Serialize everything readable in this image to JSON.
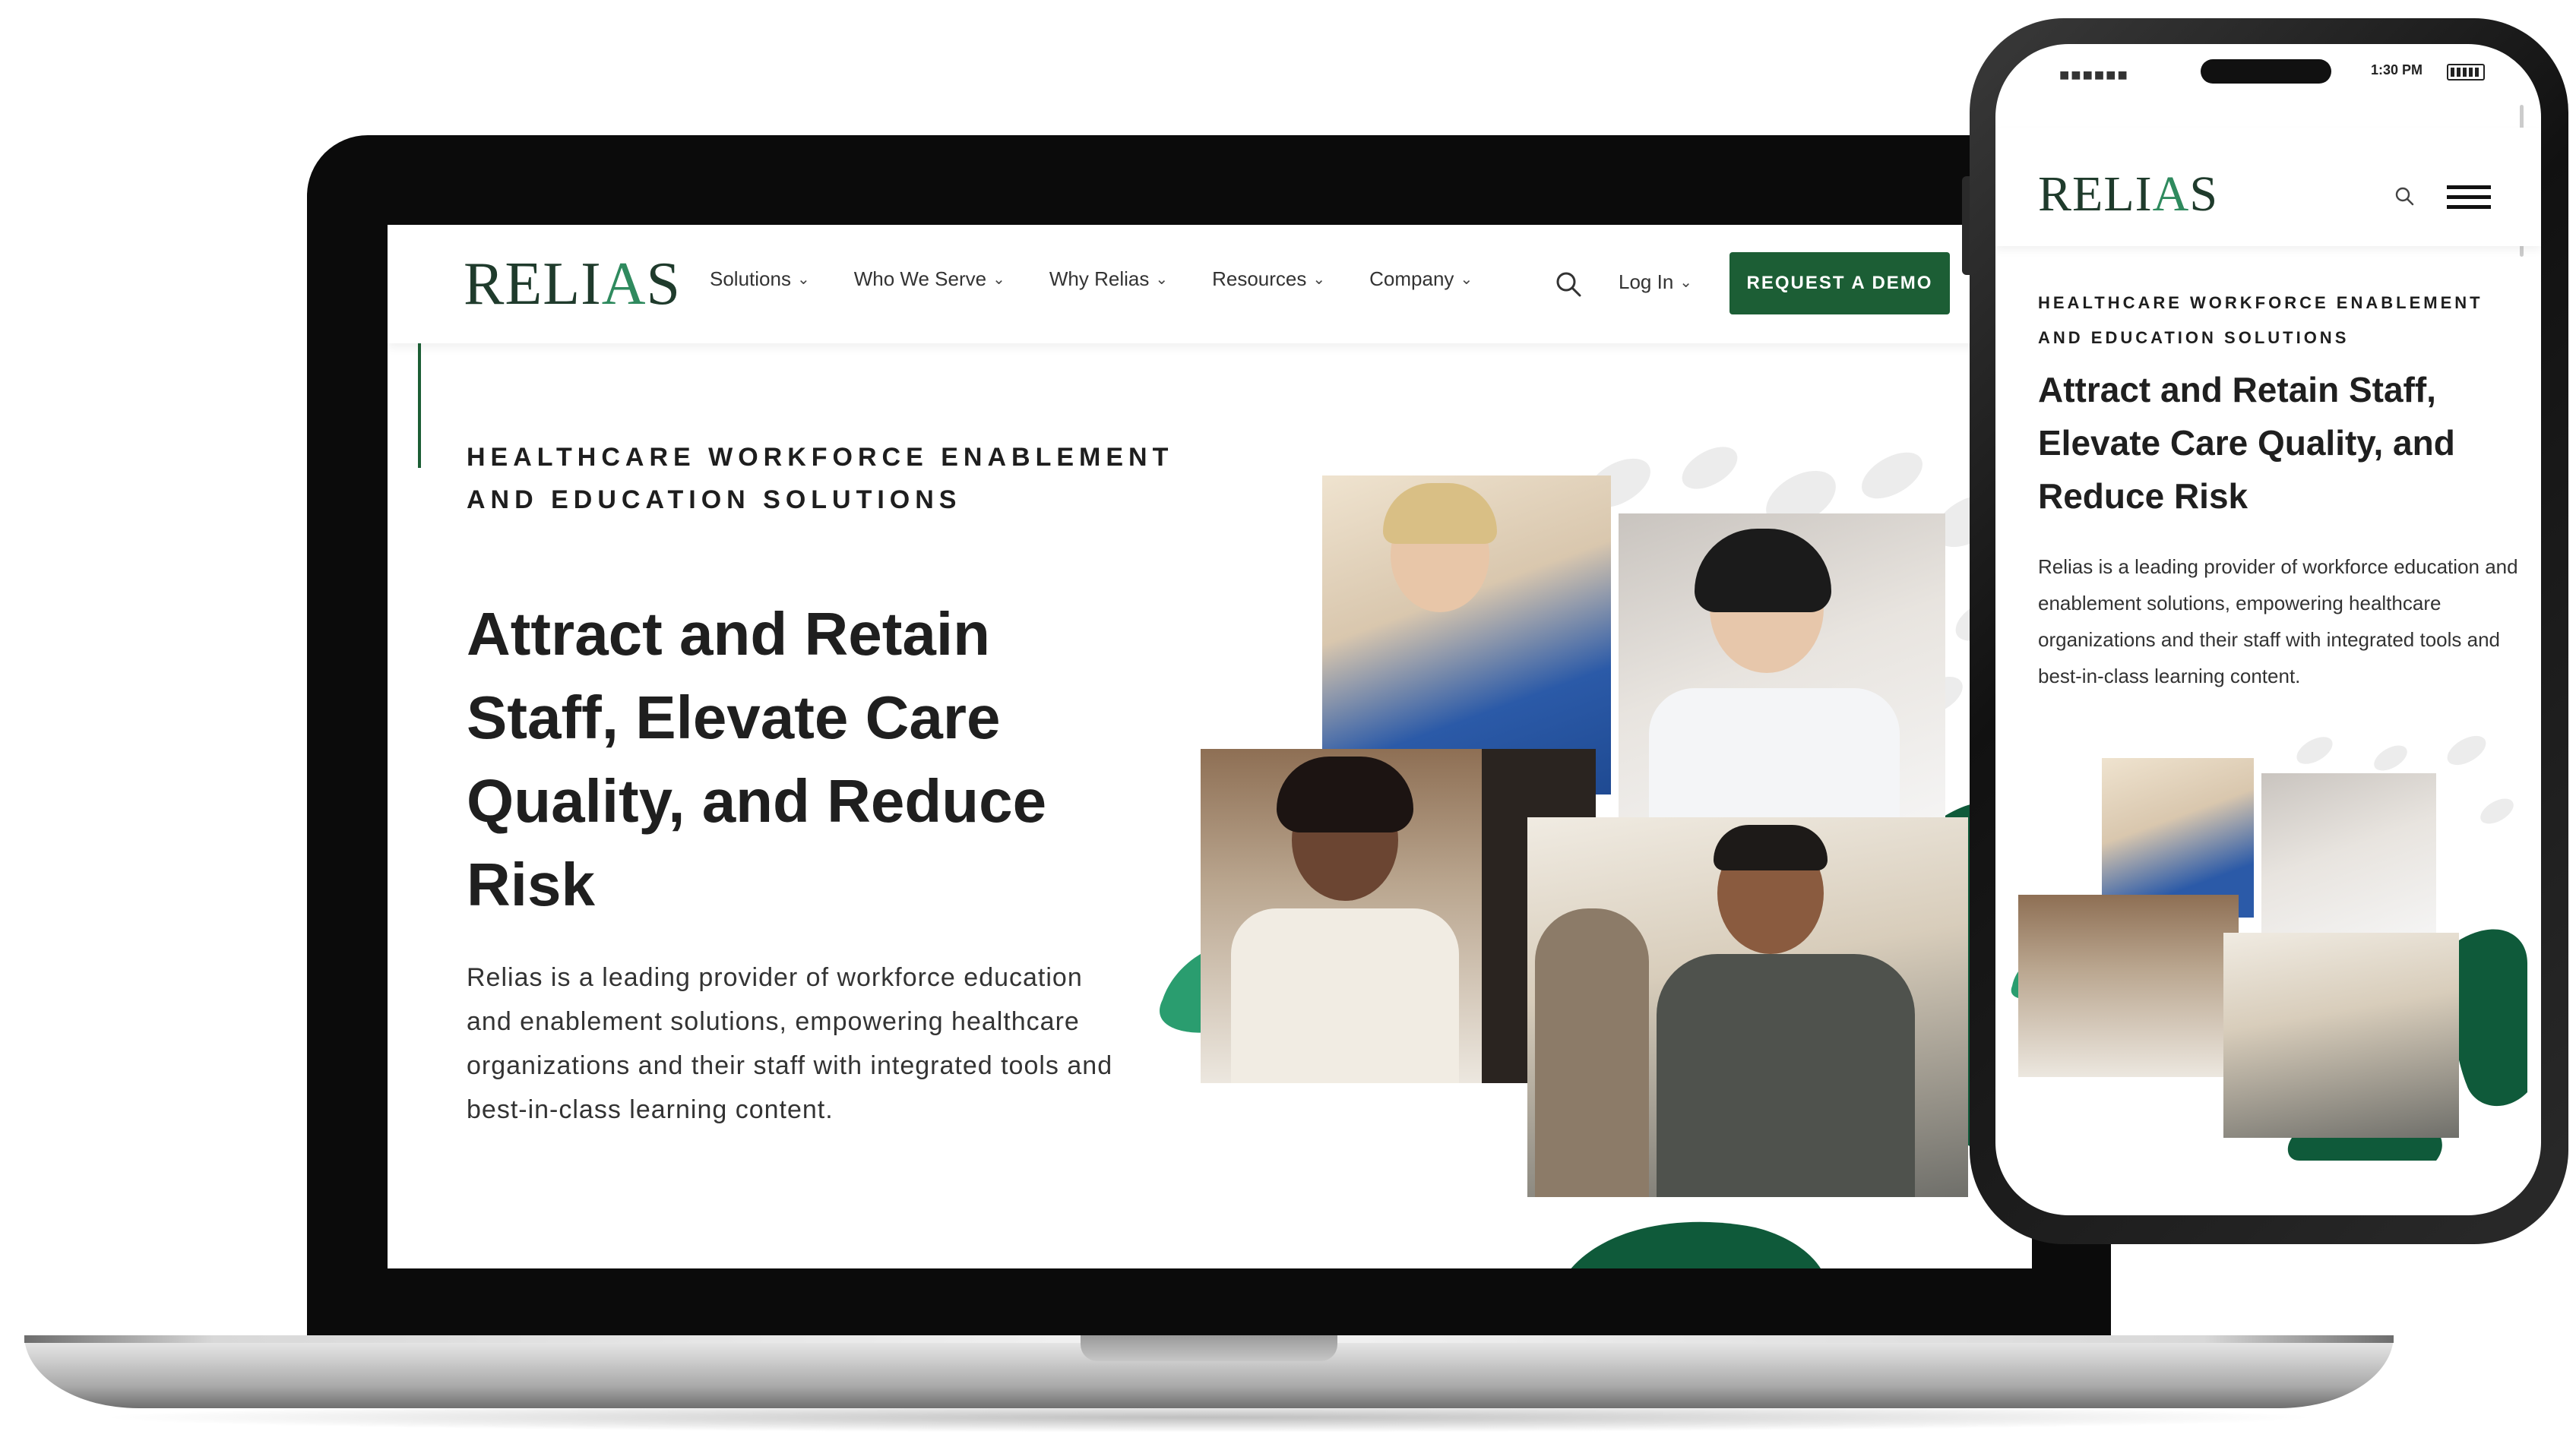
{
  "brand": {
    "logo_pre": "RELI",
    "logo_accent": "A",
    "logo_post": "S",
    "primary_green": "#1c5e35",
    "accent_green": "#2a9d6f",
    "dark_green": "#0f5a3a"
  },
  "desktop": {
    "nav": {
      "items": [
        {
          "label": "Solutions"
        },
        {
          "label": "Who We Serve"
        },
        {
          "label": "Why Relias"
        },
        {
          "label": "Resources"
        },
        {
          "label": "Company"
        }
      ],
      "login": "Log In",
      "cta": "REQUEST A DEMO"
    },
    "hero": {
      "eyebrow": "HEALTHCARE WORKFORCE ENABLEMENT AND EDUCATION SOLUTIONS",
      "title": "Attract and Retain Staff, Elevate Care Quality, and Reduce Risk",
      "body": "Relias is a leading provider of workforce education and enablement solutions, empowering healthcare organizations and their staff with integrated tools and best-in-class learning content."
    }
  },
  "mobile": {
    "status": {
      "time": "1:30 PM"
    },
    "hero": {
      "eyebrow": "HEALTHCARE WORKFORCE ENABLEMENT AND EDUCATION SOLUTIONS",
      "title": "Attract and Retain Staff, Elevate Care Quality, and Reduce Risk",
      "body": "Relias is a leading provider of workforce education and enablement solutions, empowering healthcare organizations and their staff with integrated tools and best-in-class learning content."
    }
  },
  "icons": {
    "search": "search-icon",
    "menu": "hamburger-menu-icon",
    "chevron": "chevron-down-icon"
  }
}
